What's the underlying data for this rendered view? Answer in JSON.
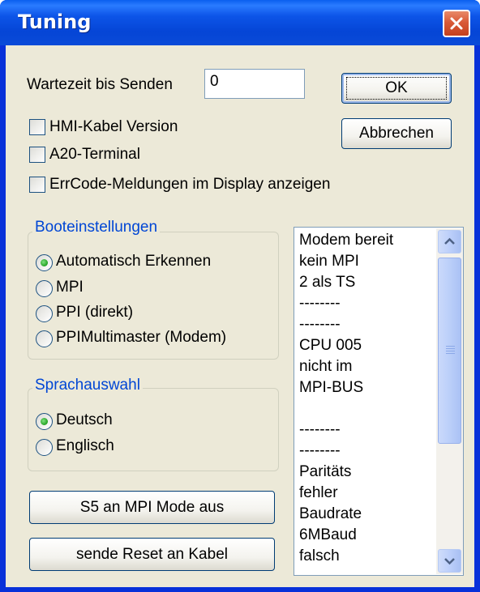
{
  "window": {
    "title": "Tuning"
  },
  "form": {
    "wait_label": "Wartezeit bis Senden",
    "wait_value": "0",
    "ok_label": "OK",
    "cancel_label": "Abbrechen",
    "checkboxes": [
      {
        "label": "HMI-Kabel Version",
        "checked": false
      },
      {
        "label": "A20-Terminal",
        "checked": false
      },
      {
        "label": "ErrCode-Meldungen im Display anzeigen",
        "checked": false
      }
    ]
  },
  "boot_group": {
    "title": "Booteinstellungen",
    "options": [
      {
        "label": "Automatisch Erkennen",
        "selected": true
      },
      {
        "label": "MPI",
        "selected": false
      },
      {
        "label": "PPI (direkt)",
        "selected": false
      },
      {
        "label": "PPIMultimaster (Modem)",
        "selected": false
      }
    ]
  },
  "language_group": {
    "title": "Sprachauswahl",
    "options": [
      {
        "label": "Deutsch",
        "selected": true
      },
      {
        "label": "Englisch",
        "selected": false
      }
    ]
  },
  "buttons": {
    "s5_mpi": "S5 an MPI Mode aus",
    "reset": "sende Reset an Kabel"
  },
  "status_list": {
    "lines": [
      "Modem bereit",
      "kein MPI",
      "2 als TS",
      "--------",
      "--------",
      "CPU  005",
      "nicht im",
      "MPI-BUS",
      "",
      "--------",
      "--------",
      "Paritäts",
      "fehler",
      "Baudrate",
      " 6MBaud",
      "falsch"
    ]
  },
  "colors": {
    "titlebar": "#0545d6",
    "close_button": "#d95a38",
    "dialog_background": "#ece9d8",
    "groupbox_title": "#0046d5",
    "radio_selected": "#21a121"
  }
}
